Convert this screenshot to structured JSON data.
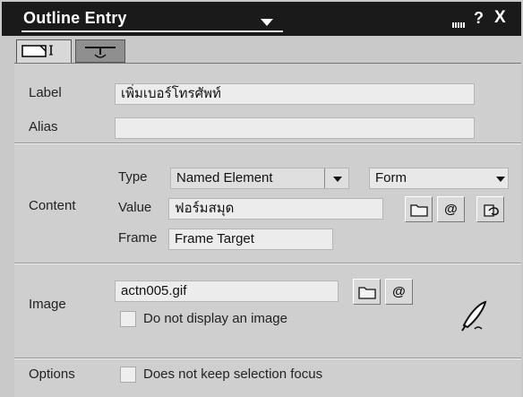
{
  "window": {
    "title": "Outline Entry"
  },
  "tabs": [
    {
      "name": "basics",
      "icon": "page-icon"
    },
    {
      "name": "advanced",
      "icon": "hat-icon"
    }
  ],
  "label_section": {
    "label_caption": "Label",
    "label_value": "เพิ่มเบอร์โทรศัพท์",
    "alias_caption": "Alias",
    "alias_value": ""
  },
  "content_section": {
    "caption": "Content",
    "type_caption": "Type",
    "type_value": "Named Element",
    "type_kind": "Form",
    "value_caption": "Value",
    "value_value": "ฟอร์มสมุด",
    "frame_caption": "Frame",
    "frame_value": "Frame Target"
  },
  "image_section": {
    "caption": "Image",
    "file_value": "actn005.gif",
    "no_image_label": "Do not display an image"
  },
  "options_section": {
    "caption": "Options",
    "keep_focus_label": "Does not keep selection focus"
  }
}
